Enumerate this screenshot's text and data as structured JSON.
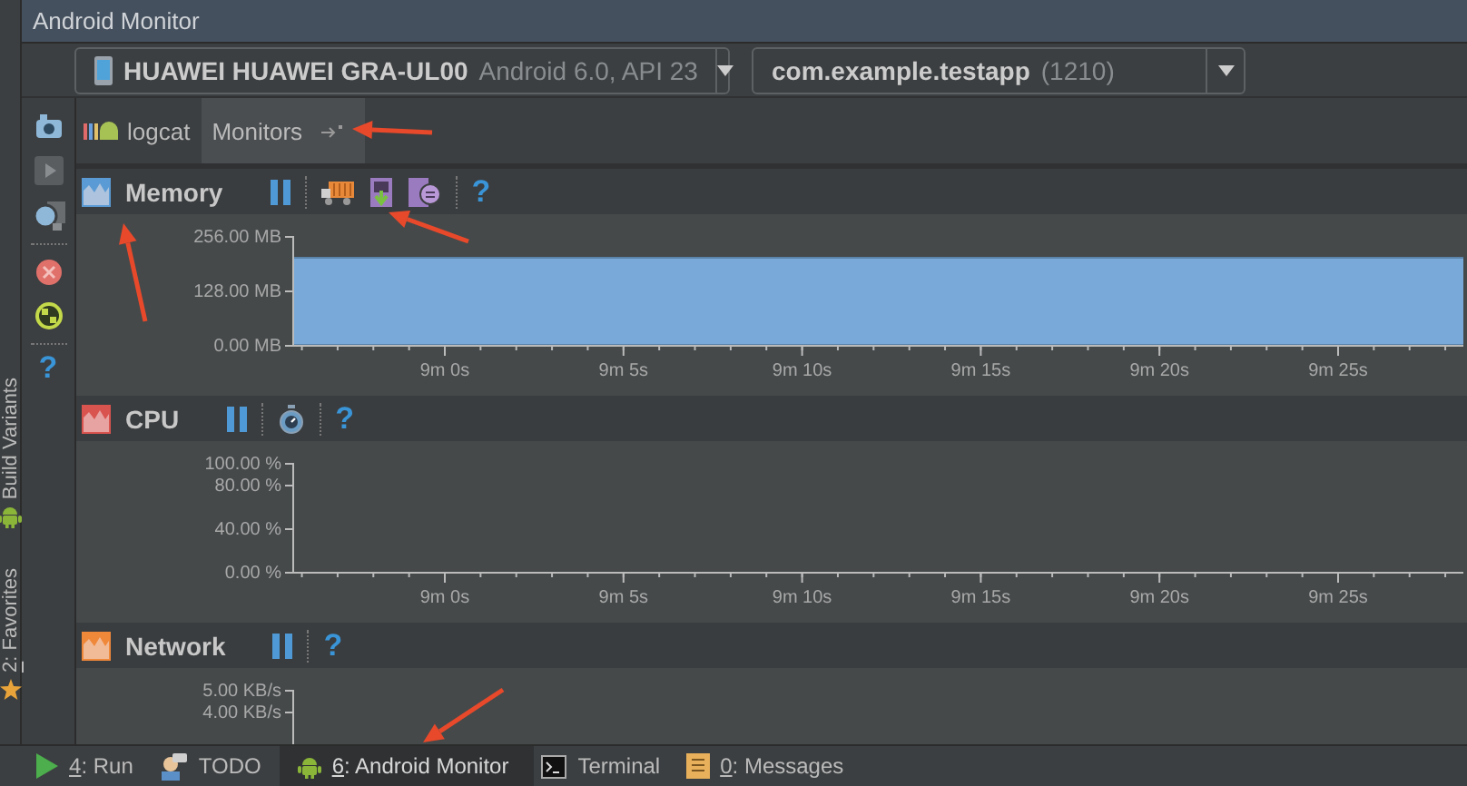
{
  "window": {
    "title": "Android Monitor"
  },
  "device_selector": {
    "device": "HUAWEI HUAWEI GRA-UL00",
    "detail": "Android 6.0, API 23"
  },
  "process_selector": {
    "name": "com.example.testapp",
    "detail": "(1210)"
  },
  "side_tabs": [
    {
      "label": "Build Variants",
      "kind": "android"
    },
    {
      "mnemonic": "2",
      "label": ": Favorites",
      "kind": "star"
    }
  ],
  "left_toolbar": {
    "groups": [
      [
        {
          "kind": "camera"
        },
        {
          "kind": "play"
        },
        {
          "kind": "record"
        }
      ],
      [
        {
          "kind": "stop"
        },
        {
          "kind": "gc"
        }
      ]
    ],
    "help": "?"
  },
  "tabs": [
    {
      "label": "logcat",
      "kind": "logcat",
      "selected": false
    },
    {
      "label": "Monitors",
      "kind": "monitors",
      "selected": true
    }
  ],
  "monitors": [
    {
      "name": "Memory",
      "color": "#5b9bd5",
      "tool_groups": [
        [
          {
            "kind": "pause"
          }
        ],
        [
          {
            "kind": "gc_truck"
          },
          {
            "kind": "heap_dump"
          },
          {
            "kind": "allocation"
          }
        ]
      ],
      "help": "?",
      "chart_data": {
        "type": "area",
        "categories": [
          null,
          "9m 0s",
          "9m 5s",
          "9m 10s",
          "9m 15s",
          "9m 20s",
          "9m 25s",
          null
        ],
        "ylim": [
          0,
          256
        ],
        "yticks": [
          {
            "value": 256,
            "label": "256.00 MB"
          },
          {
            "value": 128,
            "label": "128.00 MB"
          },
          {
            "value": 0,
            "label": "0.00 MB"
          }
        ],
        "series": [
          {
            "color": "#78a9d8",
            "values": [
              205,
              205,
              205,
              205,
              205,
              205,
              205,
              205
            ]
          }
        ]
      }
    },
    {
      "name": "CPU",
      "color": "#d9534f",
      "tool_groups": [
        [
          {
            "kind": "pause"
          }
        ],
        [
          {
            "kind": "stopwatch"
          }
        ]
      ],
      "help": "?",
      "chart_data": {
        "type": "line",
        "categories": [
          null,
          "9m 0s",
          "9m 5s",
          "9m 10s",
          "9m 15s",
          "9m 20s",
          "9m 25s",
          null
        ],
        "ylim": [
          0,
          100
        ],
        "yticks": [
          {
            "value": 100,
            "label": "100.00 %"
          },
          {
            "value": 80,
            "label": "80.00 %"
          },
          {
            "value": 40,
            "label": "40.00 %"
          },
          {
            "value": 0,
            "label": "0.00 %"
          }
        ]
      }
    },
    {
      "name": "Network",
      "color": "#f0883a",
      "tool_groups": [
        [
          {
            "kind": "pause"
          }
        ]
      ],
      "help": "?",
      "chart_data": {
        "type": "line",
        "categories": [
          null,
          null,
          null,
          null,
          null,
          null,
          null,
          null
        ],
        "ylim": [
          2.5,
          5
        ],
        "yticks": [
          {
            "value": 5,
            "label": "5.00 KB/s"
          },
          {
            "value": 4,
            "label": "4.00 KB/s"
          }
        ]
      }
    }
  ],
  "bottom_bar": [
    {
      "kind": "run",
      "mnemonic": "4",
      "label": ": Run",
      "selected": false
    },
    {
      "kind": "todo",
      "label": "TODO",
      "selected": false
    },
    {
      "kind": "android",
      "mnemonic": "6",
      "label": ": Android Monitor",
      "selected": true
    },
    {
      "kind": "terminal",
      "label": "Terminal",
      "selected": false
    },
    {
      "kind": "messages",
      "mnemonic": "0",
      "label": ": Messages",
      "selected": false
    }
  ]
}
